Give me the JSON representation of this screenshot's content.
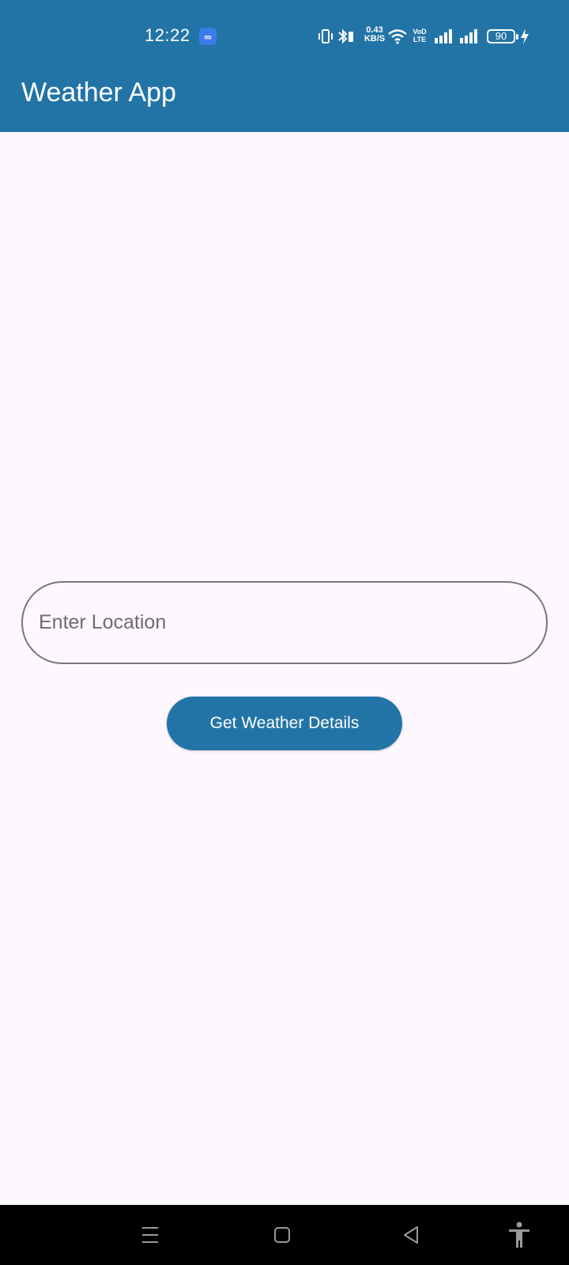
{
  "colors": {
    "primary": "#2374A6",
    "background": "#FDF8FD",
    "outline": "#7A757F",
    "on_primary": "#FFFFFF"
  },
  "status_bar": {
    "time": "12:22",
    "app_badge_icon": "infinity-icon",
    "network_speed_value": "0.43",
    "network_speed_unit": "KB/S",
    "volte_top": "VoD",
    "volte_bottom": "LTE",
    "battery_level": "90",
    "icons": [
      "vibrate-icon",
      "bluetooth-icon",
      "wifi-icon",
      "signal-icon",
      "signal-icon",
      "battery-icon",
      "charging-icon"
    ]
  },
  "app_bar": {
    "title": "Weather App"
  },
  "form": {
    "location_placeholder": "Enter Location",
    "location_value": "",
    "submit_label": "Get Weather Details"
  },
  "nav_bar": {
    "icons": [
      "menu-icon",
      "home-icon",
      "back-icon",
      "accessibility-icon"
    ]
  }
}
